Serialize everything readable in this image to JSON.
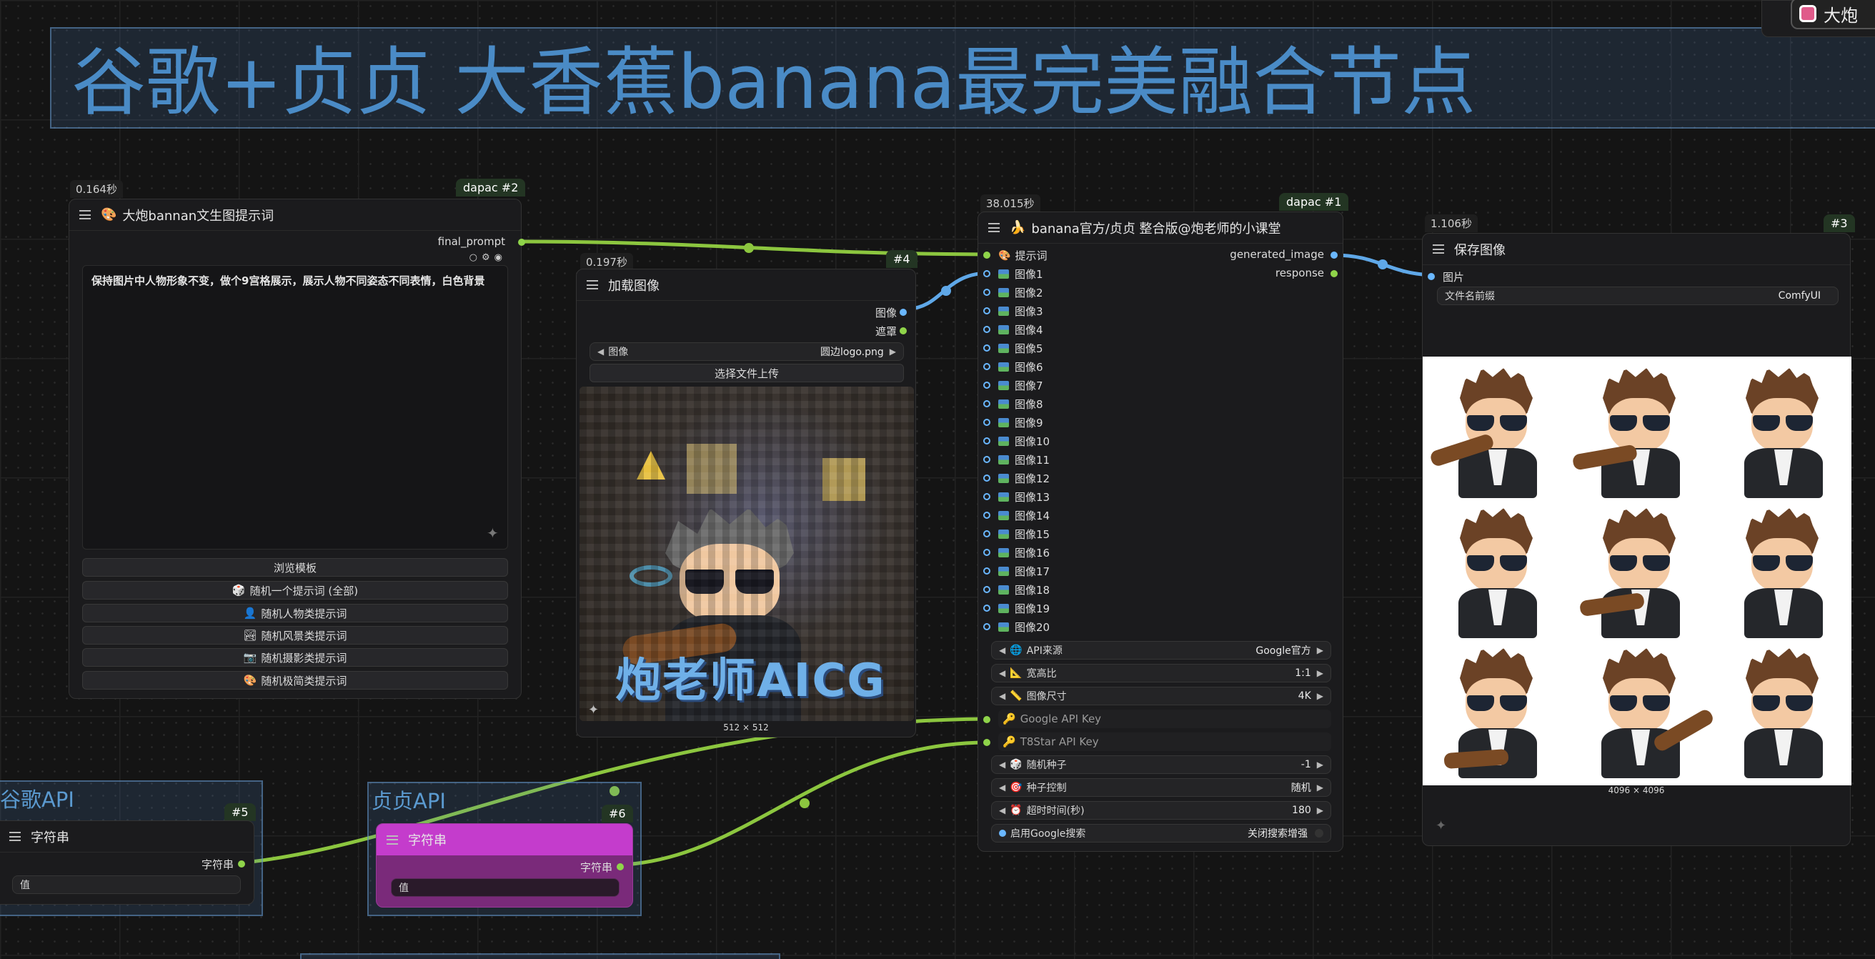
{
  "groups": {
    "main_title": "谷歌+贞贞 大香蕉banana最完美融合节点",
    "google_api": "谷歌API",
    "zhenzhen_api": "贞贞API"
  },
  "prompt_node": {
    "time": "0.164秒",
    "id": "dapac #2",
    "title": "大炮bannan文生图提示词",
    "output_label": "final_prompt",
    "prompt_text": "保持图片中人物形象不变，做个9宫格展示，展示人物不同姿态不同表情，白色背景",
    "buttons": [
      "浏览模板",
      "随机一个提示词 (全部)",
      "随机人物类提示词",
      "随机风景类提示词",
      "随机摄影类提示词",
      "随机极简类提示词"
    ]
  },
  "load_node": {
    "time": "0.197秒",
    "id": "#4",
    "title": "加载图像",
    "outputs": [
      "图像",
      "遮罩"
    ],
    "image_label": "图像",
    "image_value": "圆边logo.png",
    "upload_button": "选择文件上传",
    "watermark": "炮老师AICG",
    "dims": "512 × 512"
  },
  "banana_node": {
    "time": "38.015秒",
    "id": "dapac #1",
    "title": "banana官方/贞贞 整合版@炮老师的小课堂",
    "inputs": [
      "提示词",
      "图像1",
      "图像2",
      "图像3",
      "图像4",
      "图像5",
      "图像6",
      "图像7",
      "图像8",
      "图像9",
      "图像10",
      "图像11",
      "图像12",
      "图像13",
      "图像14",
      "图像15",
      "图像16",
      "图像17",
      "图像18",
      "图像19",
      "图像20"
    ],
    "outputs": [
      "generated_image",
      "response"
    ],
    "widgets": [
      {
        "label": "API来源",
        "value": "Google官方"
      },
      {
        "label": "宽高比",
        "value": "1:1"
      },
      {
        "label": "图像尺寸",
        "value": "4K"
      }
    ],
    "key_inputs": [
      "Google API Key",
      "T8Star API Key"
    ],
    "widgets2": [
      {
        "label": "随机种子",
        "value": "-1"
      },
      {
        "label": "种子控制",
        "value": "随机"
      },
      {
        "label": "超时时间(秒)",
        "value": "180"
      }
    ],
    "toggle": {
      "label": "启用Google搜索",
      "value": "关闭搜索增强"
    }
  },
  "save_node": {
    "time": "1.106秒",
    "id": "#3",
    "title": "保存图像",
    "input_label": "图片",
    "prefix_label": "文件名前缀",
    "prefix_value": "ComfyUI",
    "dims": "4096 × 4096"
  },
  "string_node_google": {
    "id": "#5",
    "title": "字符串",
    "output_label": "字符串",
    "placeholder": "值"
  },
  "string_node_zhenzhen": {
    "id": "#6",
    "title": "字符串",
    "output_label": "字符串",
    "placeholder": "值"
  },
  "top_right_button": "大炮"
}
